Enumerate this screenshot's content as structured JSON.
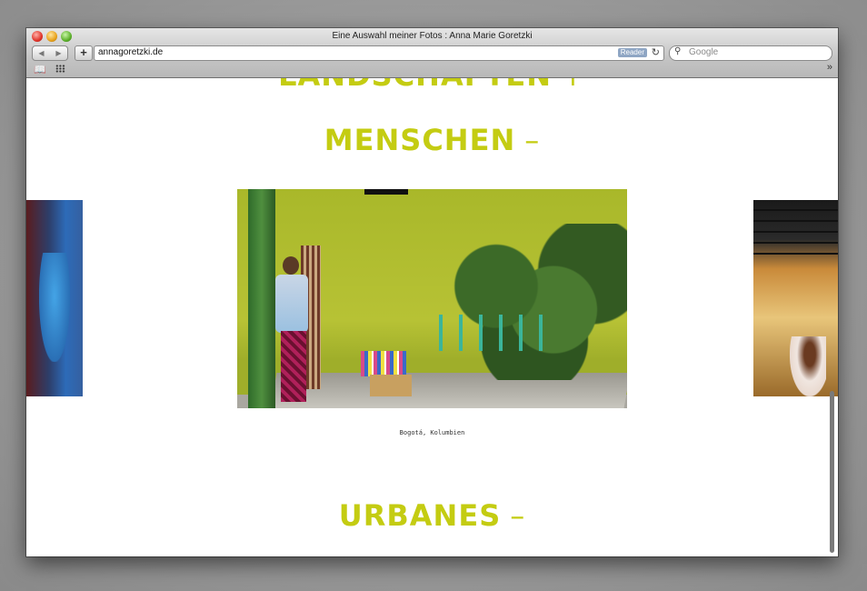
{
  "browser": {
    "window_title": "Eine Auswahl meiner Fotos : Anna Marie Goretzki",
    "url": "annagoretzki.de",
    "reader_label": "Reader",
    "search_placeholder": "Google",
    "icons": {
      "back": "back-arrow-icon",
      "forward": "forward-arrow-icon",
      "add": "plus-icon",
      "reload": "reload-icon",
      "search": "magnifier-icon",
      "bookmarks": "open-book-icon",
      "top_sites": "grid-icon",
      "overflow": "double-chevron-icon"
    }
  },
  "page": {
    "sections": [
      {
        "title": "LANDSCHAFTEN",
        "sign": "+"
      },
      {
        "title": "MENSCHEN",
        "sign": "–"
      },
      {
        "title": "URBANES",
        "sign": "–"
      }
    ],
    "gallery": {
      "caption": "Bogotá, Kolumbien"
    },
    "accent_color": "#c4cc12"
  }
}
